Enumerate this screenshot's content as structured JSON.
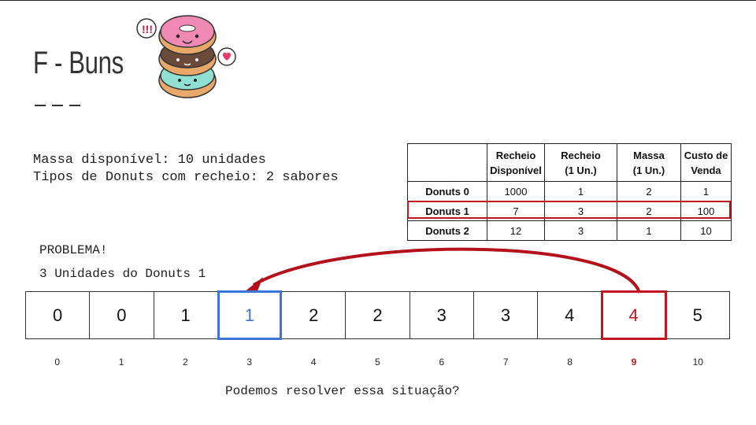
{
  "slide": {
    "title": "F - Buns",
    "info_lines": [
      "Massa disponível: 10 unidades",
      "Tipos de Donuts com recheio: 2 sabores"
    ],
    "problem_label": "PROBLEMA!",
    "problem_detail": "3 Unidades do Donuts 1",
    "question": "Podemos resolver essa situação?"
  },
  "table": {
    "headers": [
      {
        "line1": "",
        "line2": ""
      },
      {
        "line1": "Recheio",
        "line2": "Disponível"
      },
      {
        "line1": "Recheio",
        "line2": "(1 Un.)"
      },
      {
        "line1": "Massa",
        "line2": "(1 Un.)"
      },
      {
        "line1": "Custo de",
        "line2": "Venda"
      }
    ],
    "rows": [
      {
        "name": "Donuts 0",
        "cells": [
          "1000",
          "1",
          "2",
          "1"
        ]
      },
      {
        "name": "Donuts 1",
        "cells": [
          "7",
          "3",
          "2",
          "100"
        ]
      },
      {
        "name": "Donuts 2",
        "cells": [
          "12",
          "3",
          "1",
          "10"
        ]
      }
    ]
  },
  "dp_array": {
    "values": [
      "0",
      "0",
      "1",
      "1",
      "2",
      "2",
      "3",
      "3",
      "4",
      "4",
      "5"
    ],
    "indices": [
      "0",
      "1",
      "2",
      "3",
      "4",
      "5",
      "6",
      "7",
      "8",
      "9",
      "10"
    ]
  },
  "colors": {
    "accent_red": "#c0161f",
    "accent_blue": "#3a74d6"
  }
}
